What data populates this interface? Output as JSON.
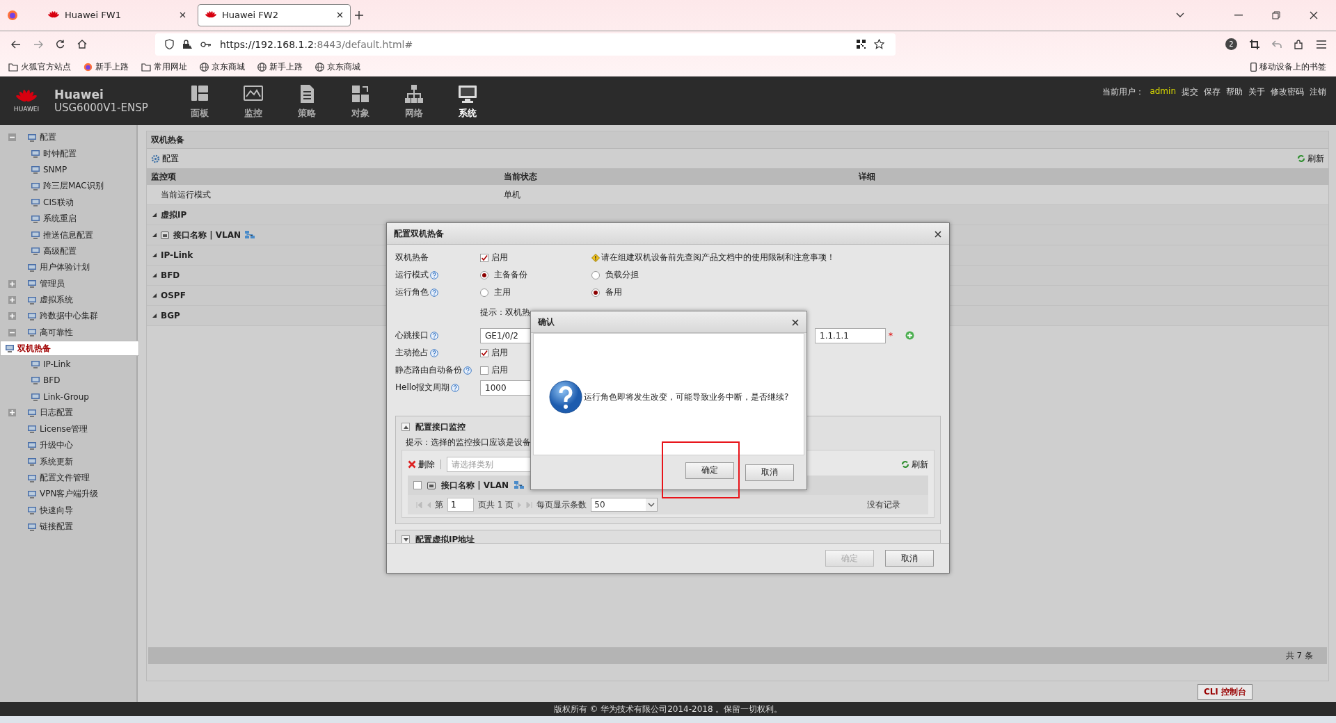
{
  "browser": {
    "tabs": [
      {
        "title": "Huawei FW1",
        "selected": false
      },
      {
        "title": "Huawei FW2",
        "selected": true
      }
    ],
    "url_host": "https://192.168.1.2",
    "url_rest": ":8443/default.html#",
    "badge": "2",
    "bookmarks": [
      {
        "kind": "folder",
        "label": "火狐官方站点"
      },
      {
        "kind": "firefox",
        "label": "新手上路"
      },
      {
        "kind": "folder",
        "label": "常用网址"
      },
      {
        "kind": "globe",
        "label": "京东商城"
      },
      {
        "kind": "globe",
        "label": "新手上路"
      },
      {
        "kind": "globe",
        "label": "京东商城"
      }
    ],
    "mobile_bookmarks": "移动设备上的书签"
  },
  "header": {
    "brand": "Huawei",
    "logo_text": "HUAWEI",
    "model": "USG6000V1-ENSP",
    "nav": [
      {
        "label": "面板",
        "selected": false
      },
      {
        "label": "监控",
        "selected": false
      },
      {
        "label": "策略",
        "selected": false
      },
      {
        "label": "对象",
        "selected": false
      },
      {
        "label": "网络",
        "selected": false
      },
      {
        "label": "系统",
        "selected": true
      }
    ],
    "user_label": "当前用户：",
    "user": "admin",
    "links": [
      "提交",
      "保存",
      "帮助",
      "关于",
      "修改密码",
      "注销"
    ]
  },
  "sidebar": {
    "items": [
      {
        "label": "配置",
        "expanded": true,
        "selected": false,
        "children": [
          {
            "label": "时钟配置",
            "selected": false
          },
          {
            "label": "SNMP",
            "selected": false
          },
          {
            "label": "跨三层MAC识别",
            "selected": false
          },
          {
            "label": "CIS联动",
            "selected": false
          },
          {
            "label": "系统重启",
            "selected": false
          },
          {
            "label": "推送信息配置",
            "selected": false
          },
          {
            "label": "高级配置",
            "selected": false
          }
        ]
      },
      {
        "label": "用户体验计划",
        "selected": false
      },
      {
        "label": "管理员",
        "expanded": false,
        "selected": false
      },
      {
        "label": "虚拟系统",
        "expanded": false,
        "selected": false
      },
      {
        "label": "跨数据中心集群",
        "expanded": false,
        "selected": false
      },
      {
        "label": "高可靠性",
        "expanded": true,
        "selected": false,
        "children": [
          {
            "label": "双机热备",
            "selected": true
          },
          {
            "label": "IP-Link",
            "selected": false
          },
          {
            "label": "BFD",
            "selected": false
          },
          {
            "label": "Link-Group",
            "selected": false
          }
        ]
      },
      {
        "label": "日志配置",
        "expanded": false,
        "selected": false
      },
      {
        "label": "License管理",
        "selected": false
      },
      {
        "label": "升级中心",
        "selected": false
      },
      {
        "label": "系统更新",
        "selected": false
      },
      {
        "label": "配置文件管理",
        "selected": false
      },
      {
        "label": "VPN客户端升级",
        "selected": false
      },
      {
        "label": "快速向导",
        "selected": false
      },
      {
        "label": "链接配置",
        "selected": false
      }
    ]
  },
  "main": {
    "title": "双机热备",
    "config_button": "配置",
    "refresh": "刷新",
    "columns": [
      "监控项",
      "当前状态",
      "详细"
    ],
    "rows": [
      {
        "kind": "row",
        "cells": [
          "当前运行模式",
          "单机"
        ]
      },
      {
        "kind": "group",
        "label": "虚拟IP"
      },
      {
        "kind": "interface-group",
        "label": "接口名称 | VLAN"
      },
      {
        "kind": "group",
        "label": "IP-Link"
      },
      {
        "kind": "group",
        "label": "BFD"
      },
      {
        "kind": "group",
        "label": "OSPF"
      },
      {
        "kind": "group",
        "label": "BGP"
      }
    ],
    "total": "共 7 条"
  },
  "config_dialog": {
    "title": "配置双机热备",
    "fields": [
      {
        "kind": "checkbox",
        "label": "双机热备",
        "help": false,
        "checked": true,
        "option": "启用",
        "note": "请在组建双机设备前先查阅产品文档中的使用限制和注意事项！"
      },
      {
        "kind": "radio",
        "label": "运行模式",
        "help": true,
        "options": [
          {
            "label": "主备备份",
            "selected": true
          },
          {
            "label": "负载分担",
            "selected": false
          }
        ]
      },
      {
        "kind": "radio",
        "label": "运行角色",
        "help": true,
        "options": [
          {
            "label": "主用",
            "selected": false
          },
          {
            "label": "备用",
            "selected": true
          }
        ]
      },
      {
        "kind": "hint",
        "text": "提示：双机热"
      },
      {
        "kind": "interface",
        "label": "心跳接口",
        "help": true,
        "value": "GE1/0/2",
        "peer": "1.1.1.1",
        "required_mark": "*"
      },
      {
        "kind": "checkbox",
        "label": "主动抢占",
        "help": true,
        "checked": true,
        "option": "启用"
      },
      {
        "kind": "checkbox",
        "label": "静态路由自动备份",
        "help": true,
        "checked": false,
        "option": "启用"
      },
      {
        "kind": "input",
        "label": "Hello报文周期",
        "help": true,
        "value": "1000"
      }
    ],
    "monitor": {
      "title": "配置接口监控",
      "expanded": true,
      "hint": "提示：选择的监控接口应该是设备",
      "delete": "删除",
      "category_placeholder": "请选择类别",
      "refresh": "刷新",
      "column": "接口名称 | VLAN",
      "select_all": false,
      "pager": {
        "page_label": "第",
        "page": "1",
        "total": "页共 1 页",
        "per_page_label": "每页显示条数",
        "per_page": "50",
        "empty": "没有记录"
      }
    },
    "vip": {
      "title": "配置虚拟IP地址",
      "expanded": false
    },
    "buttons": [
      {
        "label": "确定",
        "disabled": true
      },
      {
        "label": "取消",
        "disabled": false
      }
    ]
  },
  "confirm": {
    "title": "确认",
    "message": "运行角色即将发生改变，可能导致业务中断，是否继续?",
    "buttons": [
      {
        "label": "确定",
        "highlighted": true
      },
      {
        "label": "取消",
        "highlighted": false
      }
    ]
  },
  "cli_button": "CLI 控制台",
  "copyright": "版权所有 © 华为技术有限公司2014-2018 。保留一切权利。"
}
